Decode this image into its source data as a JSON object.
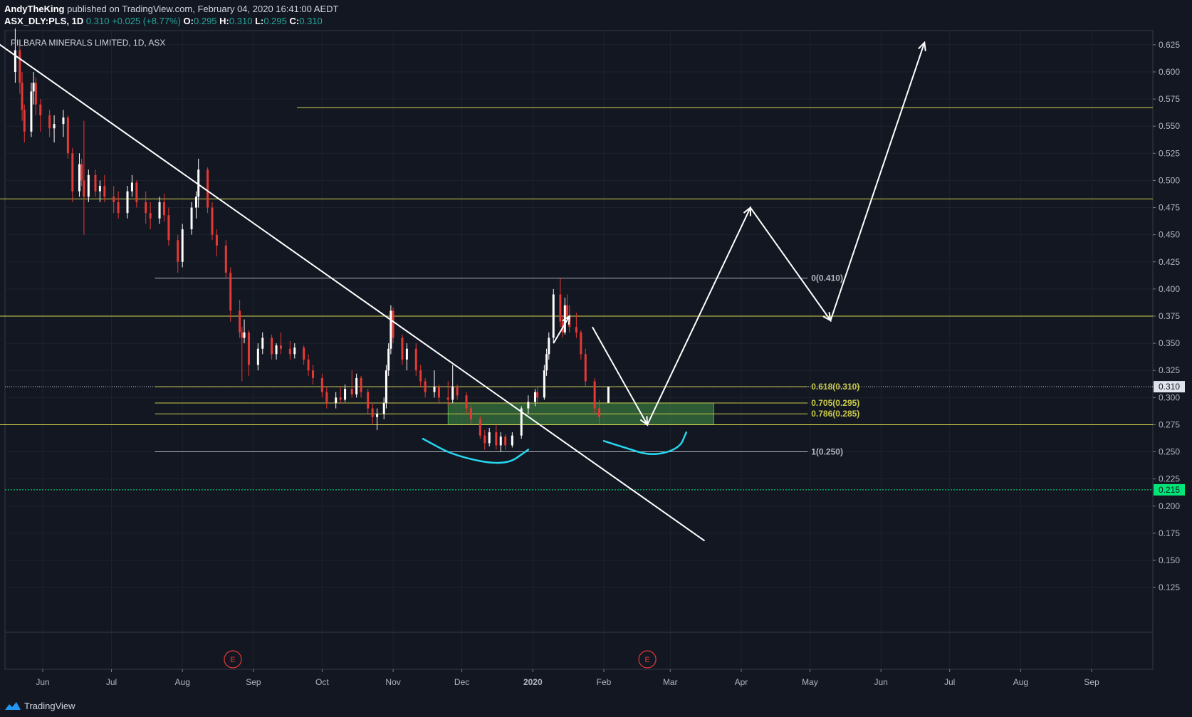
{
  "header": {
    "author": "AndyTheKing",
    "published": "published on TradingView.com, February 04, 2020 16:41:00 AEDT",
    "symbol": "ASX_DLY:PLS, 1D",
    "last": "0.310",
    "change": "+0.025 (+8.77%)",
    "o_label": "O:",
    "o": "0.295",
    "h_label": "H:",
    "h": "0.310",
    "l_label": "L:",
    "l": "0.295",
    "c_label": "C:",
    "c": "0.310"
  },
  "footer": {
    "brand": "TradingView"
  },
  "chart_data": {
    "type": "candlestick",
    "title": "PILBARA MINERALS LIMITED, 1D, ASX",
    "price_axis": {
      "ticks": [
        "0.625",
        "0.600",
        "0.575",
        "0.550",
        "0.525",
        "0.500",
        "0.475",
        "0.450",
        "0.425",
        "0.400",
        "0.375",
        "0.350",
        "0.325",
        "0.300",
        "0.275",
        "0.250",
        "0.225",
        "0.200",
        "0.175",
        "0.150",
        "0.125"
      ],
      "last_price_label": "0.310",
      "green_label": "0.215"
    },
    "time_axis": {
      "ticks": [
        {
          "label": "Jun",
          "date": "2019-06-01"
        },
        {
          "label": "Jul",
          "date": "2019-07-01"
        },
        {
          "label": "Aug",
          "date": "2019-08-01"
        },
        {
          "label": "Sep",
          "date": "2019-09-01"
        },
        {
          "label": "Oct",
          "date": "2019-10-01"
        },
        {
          "label": "Nov",
          "date": "2019-11-01"
        },
        {
          "label": "Dec",
          "date": "2019-12-01"
        },
        {
          "label": "2020",
          "date": "2020-01-01"
        },
        {
          "label": "Feb",
          "date": "2020-02-01"
        },
        {
          "label": "Mar",
          "date": "2020-03-01"
        },
        {
          "label": "Apr",
          "date": "2020-04-01"
        },
        {
          "label": "May",
          "date": "2020-05-01"
        },
        {
          "label": "Jun",
          "date": "2020-06-01"
        },
        {
          "label": "Jul",
          "date": "2020-07-01"
        },
        {
          "label": "Aug",
          "date": "2020-08-01"
        },
        {
          "label": "Sep",
          "date": "2020-09-01"
        }
      ]
    },
    "horizontal_levels": [
      {
        "price": 0.567,
        "color": "#d4d44a",
        "from": "2019-09-20"
      },
      {
        "price": 0.483,
        "color": "#d4d44a",
        "from": "2019-05-01"
      },
      {
        "price": 0.375,
        "color": "#d4d44a",
        "from": "2019-05-01"
      },
      {
        "price": 0.275,
        "color": "#d4d44a",
        "from": "2019-05-01"
      }
    ],
    "fib_levels": [
      {
        "level": "0",
        "price": "0.410",
        "label": "0(0.410)",
        "color": "#b2b5be"
      },
      {
        "level": "0.618",
        "price": "0.310",
        "label": "0.618(0.310)",
        "color": "#c8c84a"
      },
      {
        "level": "0.705",
        "price": "0.295",
        "label": "0.705(0.295)",
        "color": "#c8c84a"
      },
      {
        "level": "0.786",
        "price": "0.285",
        "label": "0.786(0.285)",
        "color": "#c8c84a"
      },
      {
        "level": "1",
        "price": "0.250",
        "label": "1(0.250)",
        "color": "#b2b5be"
      }
    ],
    "support_zone": {
      "from": "2019-11-25",
      "to": "2020-03-20",
      "low": 0.275,
      "high": 0.295,
      "color": "#4caf50"
    },
    "trendline": {
      "from": {
        "date": "2019-05-10",
        "price": 0.63
      },
      "to": {
        "date": "2020-03-16",
        "price": 0.168
      },
      "color": "#ffffff"
    },
    "projection_path": [
      {
        "date": "2020-01-27",
        "price": 0.365
      },
      {
        "date": "2020-02-20",
        "price": 0.275
      },
      {
        "date": "2020-04-05",
        "price": 0.475
      },
      {
        "date": "2020-05-10",
        "price": 0.371
      },
      {
        "date": "2020-06-20",
        "price": 0.627
      }
    ],
    "small_arrow": {
      "from": {
        "date": "2020-01-10",
        "price": 0.35
      },
      "to": {
        "date": "2020-01-17",
        "price": 0.375
      }
    },
    "event_markers": [
      {
        "date": "2019-08-23",
        "label": "E"
      },
      {
        "date": "2020-02-20",
        "label": "E"
      }
    ],
    "cyan_curves": [
      [
        {
          "date": "2019-11-14",
          "price": 0.262
        },
        {
          "date": "2019-11-28",
          "price": 0.246
        },
        {
          "date": "2019-12-20",
          "price": 0.237
        },
        {
          "date": "2019-12-30",
          "price": 0.252
        }
      ],
      [
        {
          "date": "2020-02-01",
          "price": 0.26
        },
        {
          "date": "2020-02-10",
          "price": 0.254
        },
        {
          "date": "2020-02-22",
          "price": 0.246
        },
        {
          "date": "2020-03-05",
          "price": 0.253
        },
        {
          "date": "2020-03-08",
          "price": 0.268
        }
      ]
    ],
    "current_price": 0.31,
    "dotted_green_price": 0.215,
    "up_color": "#ffffff",
    "down_color": "#e53935",
    "candles": [
      {
        "date": "2019-05-20",
        "o": 0.6,
        "h": 0.64,
        "l": 0.59,
        "c": 0.62
      },
      {
        "date": "2019-05-22",
        "o": 0.62,
        "h": 0.625,
        "l": 0.58,
        "c": 0.59
      },
      {
        "date": "2019-05-23",
        "o": 0.59,
        "h": 0.6,
        "l": 0.555,
        "c": 0.565
      },
      {
        "date": "2019-05-24",
        "o": 0.565,
        "h": 0.57,
        "l": 0.535,
        "c": 0.545
      },
      {
        "date": "2019-05-27",
        "o": 0.545,
        "h": 0.59,
        "l": 0.54,
        "c": 0.582
      },
      {
        "date": "2019-05-28",
        "o": 0.582,
        "h": 0.6,
        "l": 0.57,
        "c": 0.59
      },
      {
        "date": "2019-05-29",
        "o": 0.59,
        "h": 0.595,
        "l": 0.56,
        "c": 0.57
      },
      {
        "date": "2019-05-31",
        "o": 0.57,
        "h": 0.575,
        "l": 0.545,
        "c": 0.56
      },
      {
        "date": "2019-06-04",
        "o": 0.56,
        "h": 0.565,
        "l": 0.54,
        "c": 0.548
      },
      {
        "date": "2019-06-06",
        "o": 0.548,
        "h": 0.56,
        "l": 0.535,
        "c": 0.552
      },
      {
        "date": "2019-06-10",
        "o": 0.552,
        "h": 0.565,
        "l": 0.54,
        "c": 0.558
      },
      {
        "date": "2019-06-12",
        "o": 0.558,
        "h": 0.56,
        "l": 0.52,
        "c": 0.525
      },
      {
        "date": "2019-06-14",
        "o": 0.525,
        "h": 0.53,
        "l": 0.48,
        "c": 0.49
      },
      {
        "date": "2019-06-17",
        "o": 0.49,
        "h": 0.525,
        "l": 0.485,
        "c": 0.515
      },
      {
        "date": "2019-06-18",
        "o": 0.515,
        "h": 0.52,
        "l": 0.495,
        "c": 0.5
      },
      {
        "date": "2019-06-19",
        "o": 0.5,
        "h": 0.555,
        "l": 0.45,
        "c": 0.485
      },
      {
        "date": "2019-06-21",
        "o": 0.485,
        "h": 0.51,
        "l": 0.48,
        "c": 0.505
      },
      {
        "date": "2019-06-24",
        "o": 0.505,
        "h": 0.51,
        "l": 0.485,
        "c": 0.49
      },
      {
        "date": "2019-06-26",
        "o": 0.49,
        "h": 0.5,
        "l": 0.48,
        "c": 0.495
      },
      {
        "date": "2019-06-28",
        "o": 0.495,
        "h": 0.505,
        "l": 0.48,
        "c": 0.485
      },
      {
        "date": "2019-07-02",
        "o": 0.485,
        "h": 0.495,
        "l": 0.47,
        "c": 0.48
      },
      {
        "date": "2019-07-04",
        "o": 0.48,
        "h": 0.49,
        "l": 0.465,
        "c": 0.47
      },
      {
        "date": "2019-07-08",
        "o": 0.47,
        "h": 0.495,
        "l": 0.465,
        "c": 0.49
      },
      {
        "date": "2019-07-10",
        "o": 0.49,
        "h": 0.505,
        "l": 0.485,
        "c": 0.498
      },
      {
        "date": "2019-07-12",
        "o": 0.498,
        "h": 0.5,
        "l": 0.475,
        "c": 0.48
      },
      {
        "date": "2019-07-16",
        "o": 0.48,
        "h": 0.49,
        "l": 0.46,
        "c": 0.47
      },
      {
        "date": "2019-07-18",
        "o": 0.47,
        "h": 0.48,
        "l": 0.455,
        "c": 0.465
      },
      {
        "date": "2019-07-22",
        "o": 0.465,
        "h": 0.485,
        "l": 0.46,
        "c": 0.48
      },
      {
        "date": "2019-07-24",
        "o": 0.48,
        "h": 0.488,
        "l": 0.462,
        "c": 0.468
      },
      {
        "date": "2019-07-26",
        "o": 0.468,
        "h": 0.475,
        "l": 0.44,
        "c": 0.445
      },
      {
        "date": "2019-07-30",
        "o": 0.445,
        "h": 0.45,
        "l": 0.415,
        "c": 0.425
      },
      {
        "date": "2019-08-01",
        "o": 0.425,
        "h": 0.46,
        "l": 0.42,
        "c": 0.455
      },
      {
        "date": "2019-08-05",
        "o": 0.455,
        "h": 0.48,
        "l": 0.45,
        "c": 0.475
      },
      {
        "date": "2019-08-07",
        "o": 0.475,
        "h": 0.49,
        "l": 0.465,
        "c": 0.485
      },
      {
        "date": "2019-08-08",
        "o": 0.485,
        "h": 0.52,
        "l": 0.475,
        "c": 0.51
      },
      {
        "date": "2019-08-12",
        "o": 0.51,
        "h": 0.512,
        "l": 0.47,
        "c": 0.475
      },
      {
        "date": "2019-08-14",
        "o": 0.475,
        "h": 0.48,
        "l": 0.445,
        "c": 0.45
      },
      {
        "date": "2019-08-16",
        "o": 0.45,
        "h": 0.455,
        "l": 0.43,
        "c": 0.44
      },
      {
        "date": "2019-08-20",
        "o": 0.44,
        "h": 0.445,
        "l": 0.41,
        "c": 0.415
      },
      {
        "date": "2019-08-22",
        "o": 0.415,
        "h": 0.42,
        "l": 0.37,
        "c": 0.38
      },
      {
        "date": "2019-08-26",
        "o": 0.38,
        "h": 0.39,
        "l": 0.355,
        "c": 0.36
      },
      {
        "date": "2019-08-27",
        "o": 0.36,
        "h": 0.365,
        "l": 0.315,
        "c": 0.355
      },
      {
        "date": "2019-08-28",
        "o": 0.355,
        "h": 0.372,
        "l": 0.35,
        "c": 0.36
      },
      {
        "date": "2019-08-30",
        "o": 0.36,
        "h": 0.362,
        "l": 0.32,
        "c": 0.33
      },
      {
        "date": "2019-09-03",
        "o": 0.33,
        "h": 0.35,
        "l": 0.325,
        "c": 0.345
      },
      {
        "date": "2019-09-05",
        "o": 0.345,
        "h": 0.36,
        "l": 0.34,
        "c": 0.355
      },
      {
        "date": "2019-09-09",
        "o": 0.355,
        "h": 0.358,
        "l": 0.335,
        "c": 0.34
      },
      {
        "date": "2019-09-11",
        "o": 0.34,
        "h": 0.35,
        "l": 0.335,
        "c": 0.348
      },
      {
        "date": "2019-09-13",
        "o": 0.348,
        "h": 0.36,
        "l": 0.34,
        "c": 0.345
      },
      {
        "date": "2019-09-17",
        "o": 0.345,
        "h": 0.352,
        "l": 0.335,
        "c": 0.34
      },
      {
        "date": "2019-09-19",
        "o": 0.34,
        "h": 0.35,
        "l": 0.336,
        "c": 0.346
      },
      {
        "date": "2019-09-23",
        "o": 0.346,
        "h": 0.348,
        "l": 0.33,
        "c": 0.335
      },
      {
        "date": "2019-09-25",
        "o": 0.335,
        "h": 0.34,
        "l": 0.32,
        "c": 0.325
      },
      {
        "date": "2019-09-27",
        "o": 0.325,
        "h": 0.33,
        "l": 0.312,
        "c": 0.318
      },
      {
        "date": "2019-10-01",
        "o": 0.318,
        "h": 0.322,
        "l": 0.3,
        "c": 0.305
      },
      {
        "date": "2019-10-03",
        "o": 0.305,
        "h": 0.31,
        "l": 0.29,
        "c": 0.295
      },
      {
        "date": "2019-10-07",
        "o": 0.295,
        "h": 0.305,
        "l": 0.29,
        "c": 0.3
      },
      {
        "date": "2019-10-09",
        "o": 0.3,
        "h": 0.31,
        "l": 0.295,
        "c": 0.298
      },
      {
        "date": "2019-10-11",
        "o": 0.298,
        "h": 0.312,
        "l": 0.296,
        "c": 0.308
      },
      {
        "date": "2019-10-14",
        "o": 0.308,
        "h": 0.325,
        "l": 0.3,
        "c": 0.303
      },
      {
        "date": "2019-10-16",
        "o": 0.303,
        "h": 0.322,
        "l": 0.3,
        "c": 0.318
      },
      {
        "date": "2019-10-18",
        "o": 0.318,
        "h": 0.32,
        "l": 0.3,
        "c": 0.305
      },
      {
        "date": "2019-10-21",
        "o": 0.305,
        "h": 0.308,
        "l": 0.285,
        "c": 0.29
      },
      {
        "date": "2019-10-23",
        "o": 0.29,
        "h": 0.295,
        "l": 0.275,
        "c": 0.282
      },
      {
        "date": "2019-10-25",
        "o": 0.282,
        "h": 0.29,
        "l": 0.27,
        "c": 0.285
      },
      {
        "date": "2019-10-28",
        "o": 0.285,
        "h": 0.3,
        "l": 0.28,
        "c": 0.295
      },
      {
        "date": "2019-10-29",
        "o": 0.295,
        "h": 0.33,
        "l": 0.29,
        "c": 0.325
      },
      {
        "date": "2019-10-30",
        "o": 0.325,
        "h": 0.35,
        "l": 0.32,
        "c": 0.345
      },
      {
        "date": "2019-10-31",
        "o": 0.345,
        "h": 0.385,
        "l": 0.34,
        "c": 0.38
      },
      {
        "date": "2019-11-01",
        "o": 0.38,
        "h": 0.383,
        "l": 0.35,
        "c": 0.355
      },
      {
        "date": "2019-11-05",
        "o": 0.355,
        "h": 0.358,
        "l": 0.33,
        "c": 0.335
      },
      {
        "date": "2019-11-07",
        "o": 0.335,
        "h": 0.35,
        "l": 0.325,
        "c": 0.345
      },
      {
        "date": "2019-11-11",
        "o": 0.345,
        "h": 0.35,
        "l": 0.32,
        "c": 0.325
      },
      {
        "date": "2019-11-13",
        "o": 0.325,
        "h": 0.33,
        "l": 0.31,
        "c": 0.315
      },
      {
        "date": "2019-11-15",
        "o": 0.315,
        "h": 0.318,
        "l": 0.3,
        "c": 0.305
      },
      {
        "date": "2019-11-19",
        "o": 0.305,
        "h": 0.325,
        "l": 0.3,
        "c": 0.31
      },
      {
        "date": "2019-11-21",
        "o": 0.31,
        "h": 0.312,
        "l": 0.295,
        "c": 0.3
      },
      {
        "date": "2019-11-25",
        "o": 0.3,
        "h": 0.315,
        "l": 0.292,
        "c": 0.298
      },
      {
        "date": "2019-11-27",
        "o": 0.298,
        "h": 0.33,
        "l": 0.295,
        "c": 0.31
      },
      {
        "date": "2019-11-29",
        "o": 0.31,
        "h": 0.312,
        "l": 0.298,
        "c": 0.302
      },
      {
        "date": "2019-12-03",
        "o": 0.302,
        "h": 0.305,
        "l": 0.285,
        "c": 0.29
      },
      {
        "date": "2019-12-05",
        "o": 0.29,
        "h": 0.293,
        "l": 0.275,
        "c": 0.28
      },
      {
        "date": "2019-12-09",
        "o": 0.28,
        "h": 0.283,
        "l": 0.262,
        "c": 0.265
      },
      {
        "date": "2019-12-11",
        "o": 0.265,
        "h": 0.27,
        "l": 0.252,
        "c": 0.258
      },
      {
        "date": "2019-12-13",
        "o": 0.258,
        "h": 0.272,
        "l": 0.255,
        "c": 0.268
      },
      {
        "date": "2019-12-16",
        "o": 0.268,
        "h": 0.275,
        "l": 0.252,
        "c": 0.256
      },
      {
        "date": "2019-12-18",
        "o": 0.256,
        "h": 0.268,
        "l": 0.25,
        "c": 0.264
      },
      {
        "date": "2019-12-20",
        "o": 0.264,
        "h": 0.266,
        "l": 0.252,
        "c": 0.256
      },
      {
        "date": "2019-12-23",
        "o": 0.256,
        "h": 0.268,
        "l": 0.254,
        "c": 0.265
      },
      {
        "date": "2019-12-27",
        "o": 0.265,
        "h": 0.292,
        "l": 0.262,
        "c": 0.29
      },
      {
        "date": "2019-12-30",
        "o": 0.29,
        "h": 0.302,
        "l": 0.285,
        "c": 0.296
      },
      {
        "date": "2020-01-02",
        "o": 0.296,
        "h": 0.308,
        "l": 0.292,
        "c": 0.305
      },
      {
        "date": "2020-01-03",
        "o": 0.305,
        "h": 0.31,
        "l": 0.295,
        "c": 0.3
      },
      {
        "date": "2020-01-06",
        "o": 0.3,
        "h": 0.33,
        "l": 0.298,
        "c": 0.325
      },
      {
        "date": "2020-01-07",
        "o": 0.325,
        "h": 0.345,
        "l": 0.32,
        "c": 0.34
      },
      {
        "date": "2020-01-08",
        "o": 0.34,
        "h": 0.36,
        "l": 0.335,
        "c": 0.355
      },
      {
        "date": "2020-01-10",
        "o": 0.355,
        "h": 0.4,
        "l": 0.35,
        "c": 0.395
      },
      {
        "date": "2020-01-13",
        "o": 0.395,
        "h": 0.41,
        "l": 0.365,
        "c": 0.37
      },
      {
        "date": "2020-01-14",
        "o": 0.37,
        "h": 0.375,
        "l": 0.355,
        "c": 0.36
      },
      {
        "date": "2020-01-15",
        "o": 0.36,
        "h": 0.392,
        "l": 0.358,
        "c": 0.385
      },
      {
        "date": "2020-01-16",
        "o": 0.385,
        "h": 0.395,
        "l": 0.37,
        "c": 0.375
      },
      {
        "date": "2020-01-17",
        "o": 0.375,
        "h": 0.385,
        "l": 0.36,
        "c": 0.365
      },
      {
        "date": "2020-01-20",
        "o": 0.365,
        "h": 0.378,
        "l": 0.355,
        "c": 0.36
      },
      {
        "date": "2020-01-22",
        "o": 0.36,
        "h": 0.362,
        "l": 0.335,
        "c": 0.34
      },
      {
        "date": "2020-01-24",
        "o": 0.34,
        "h": 0.345,
        "l": 0.31,
        "c": 0.315
      },
      {
        "date": "2020-01-28",
        "o": 0.315,
        "h": 0.318,
        "l": 0.285,
        "c": 0.29
      },
      {
        "date": "2020-01-30",
        "o": 0.29,
        "h": 0.298,
        "l": 0.275,
        "c": 0.282
      },
      {
        "date": "2020-02-03",
        "o": 0.295,
        "h": 0.31,
        "l": 0.295,
        "c": 0.31
      }
    ]
  }
}
